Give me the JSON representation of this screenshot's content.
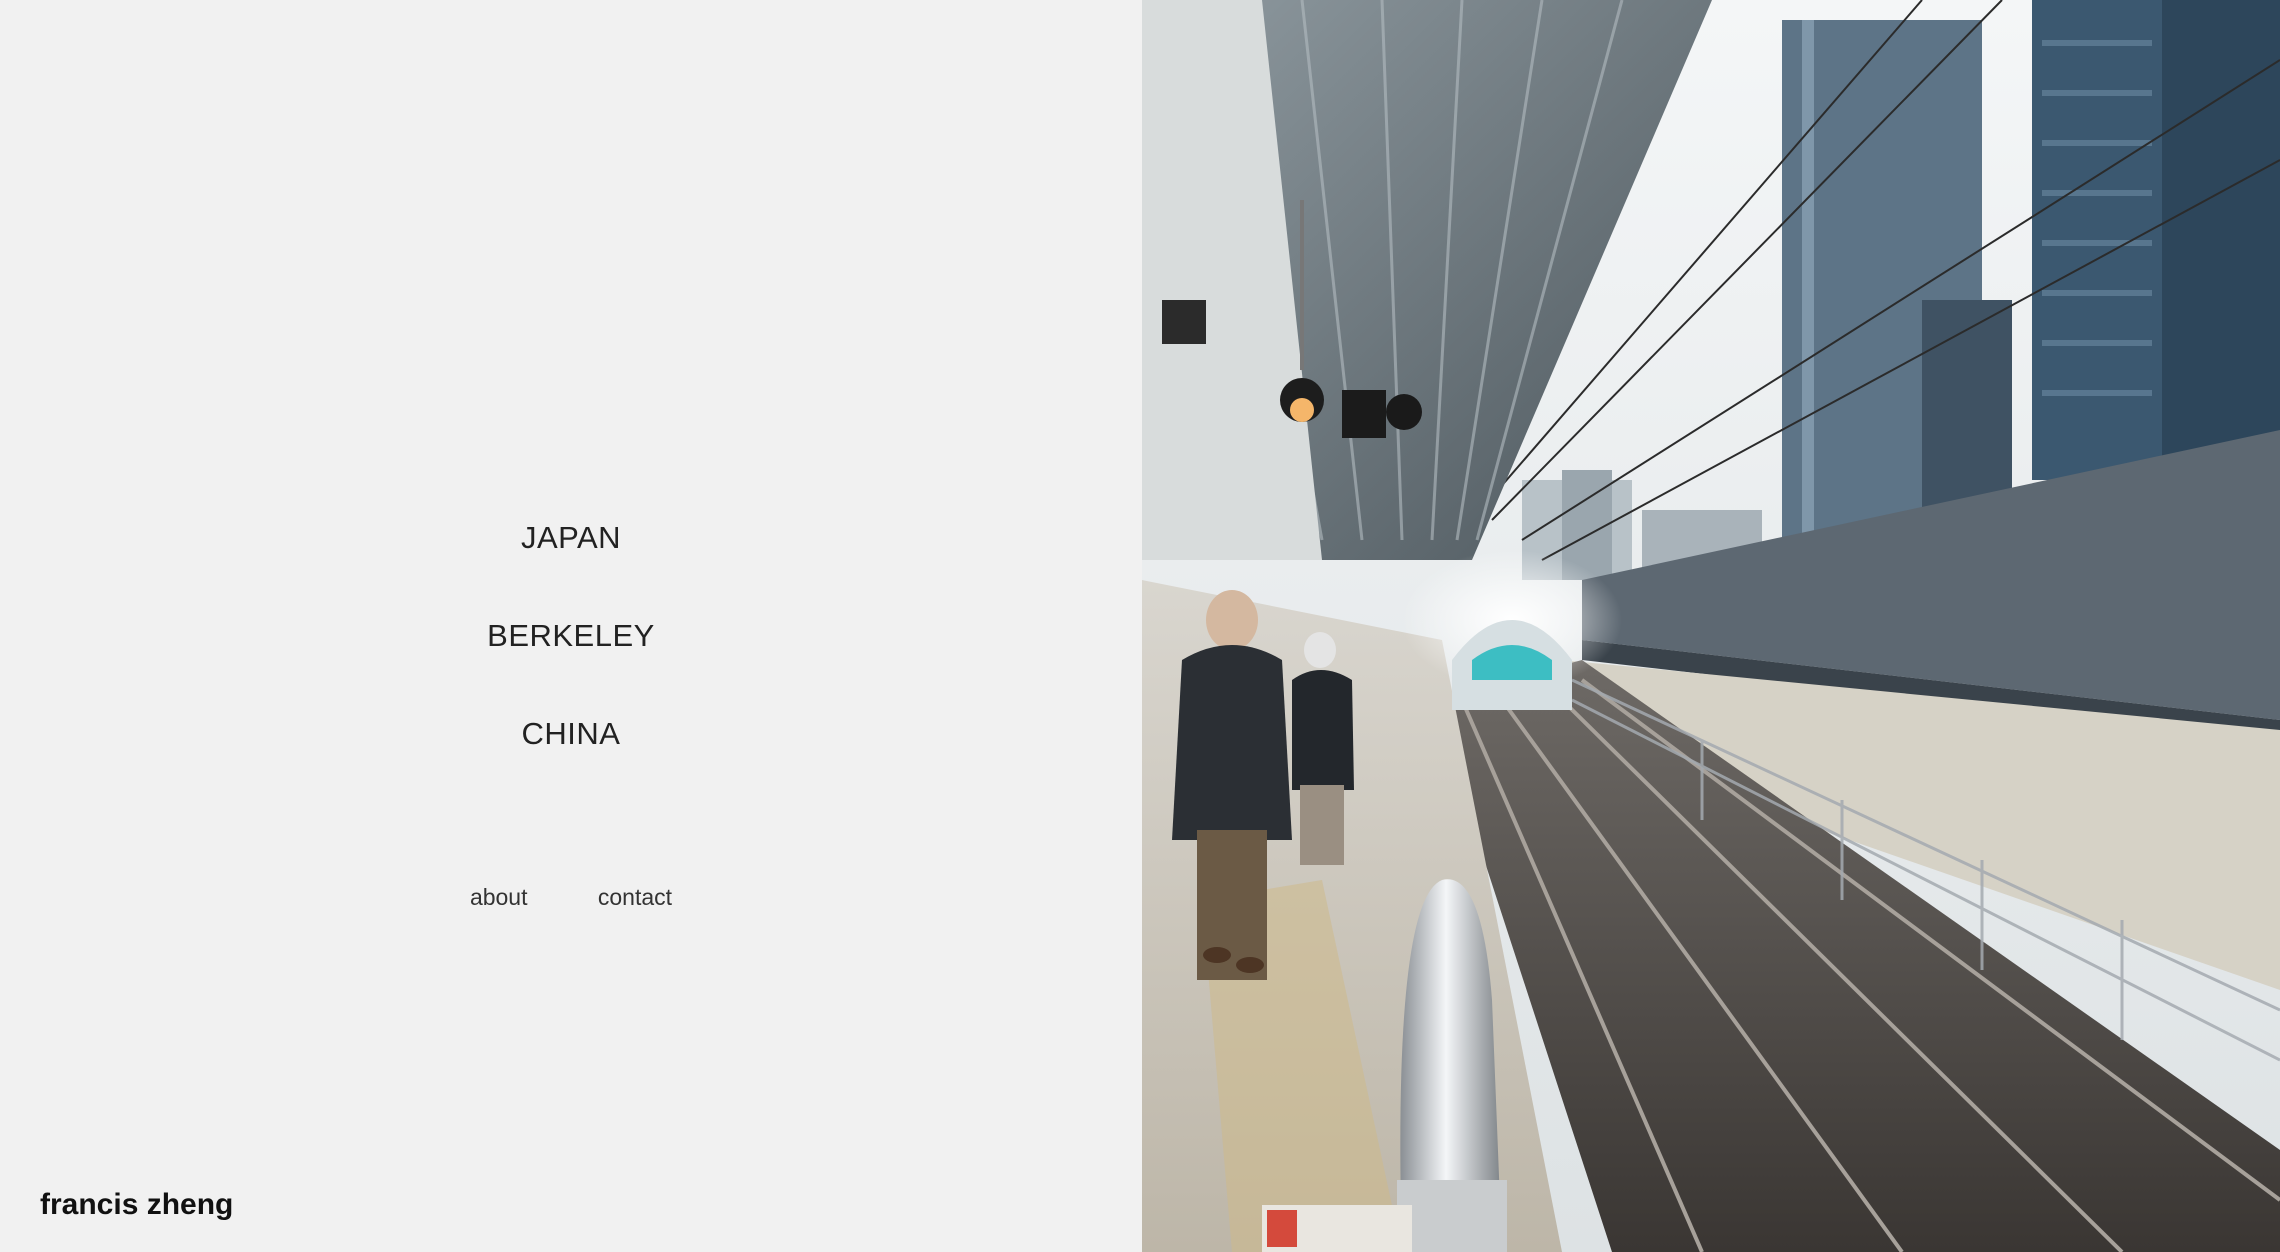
{
  "nav": {
    "items": [
      {
        "label": "JAPAN"
      },
      {
        "label": "BERKELEY"
      },
      {
        "label": "CHINA"
      }
    ]
  },
  "links": {
    "about": "about",
    "contact": "contact"
  },
  "brand": {
    "name": "francis zheng"
  },
  "photo": {
    "subject": "train-station-platform-photo"
  }
}
